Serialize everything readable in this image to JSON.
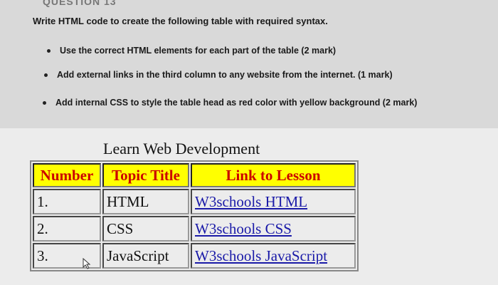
{
  "header": {
    "cut_title": "QUESTION 13"
  },
  "question": "Write HTML code to create the following table with required syntax.",
  "bullets": [
    "Use the correct HTML elements for each part of the table (2 mark)",
    "Add external links in the third column to any website from the internet. (1 mark)",
    "Add internal CSS to style the table head as red color with yellow background   (2 mark)"
  ],
  "table": {
    "caption": "Learn Web Development",
    "headers": [
      "Number",
      "Topic Title",
      "Link to Lesson"
    ],
    "rows": [
      {
        "number": "1.",
        "topic": "HTML",
        "link": "W3schools HTML"
      },
      {
        "number": "2.",
        "topic": "CSS",
        "link": "W3schools CSS"
      },
      {
        "number": "3.",
        "topic": "JavaScript",
        "link": "W3schools JavaScript"
      }
    ]
  },
  "colors": {
    "head_text": "#cc0000",
    "head_bg": "#ffff00",
    "link": "#1a1aa8"
  },
  "icons": {
    "cursor": "mouse-pointer-icon"
  }
}
